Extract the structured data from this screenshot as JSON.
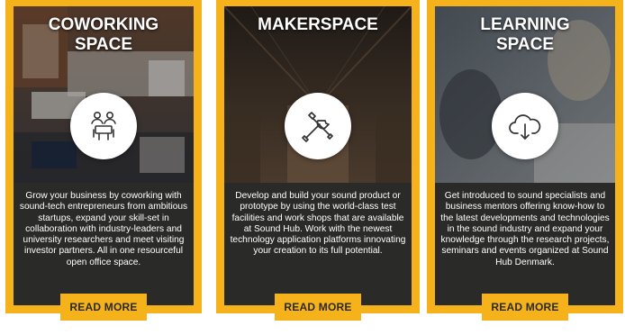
{
  "cards": [
    {
      "title": "COWORKING\nSPACE",
      "icon": "people-meeting-icon",
      "description": "Grow your business by coworking with sound-tech entrepreneurs from ambitious startups, expand your skill-set in collaboration with industry-leaders and university researchers and meet visiting investor partners. All in one resourceful open office space.",
      "button_label": "READ MORE"
    },
    {
      "title": "MAKERSPACE",
      "icon": "tools-icon",
      "description": "Develop and build your sound product or prototype by using the world-class test facilities and work shops that are available at Sound Hub. Work with the newest technology application platforms innovating your creation to its full potential.",
      "button_label": "READ MORE"
    },
    {
      "title": "LEARNING\nSPACE",
      "icon": "cloud-download-icon",
      "description": "Get introduced to sound specialists and business mentors offering know-how to the latest developments and technologies in the sound industry and expand your knowledge through the research projects, seminars and events organized at Sound Hub Denmark.",
      "button_label": "READ MORE"
    }
  ],
  "colors": {
    "accent": "#f5b21a",
    "panel": "#2a2a28",
    "text": "#ffffff"
  }
}
